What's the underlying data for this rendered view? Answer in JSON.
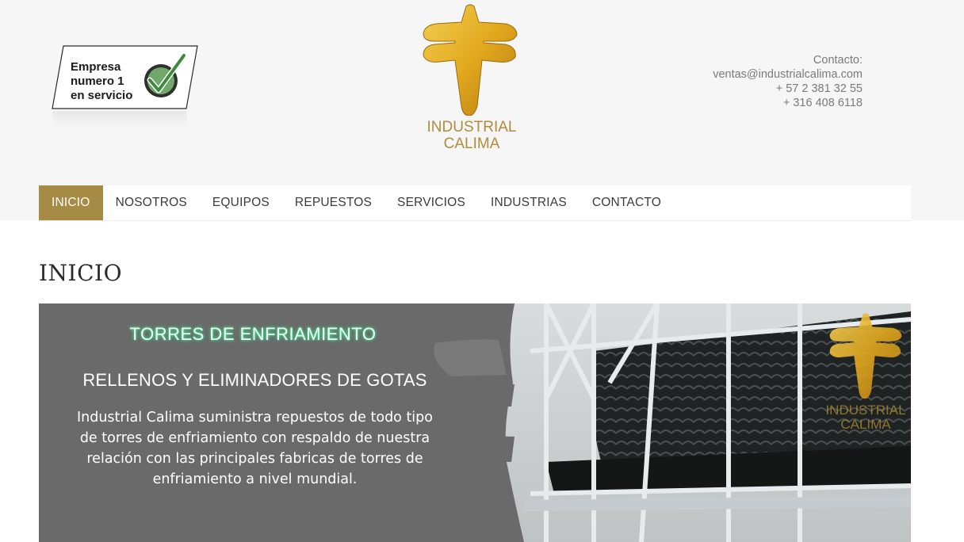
{
  "badge": {
    "lines": [
      "Empresa",
      "numero 1",
      "en servicio"
    ]
  },
  "brand": {
    "name_line1": "INDUSTRIAL",
    "name_line2": "CALIMA",
    "gold": "#b08c3a"
  },
  "contact": {
    "label": "Contacto:",
    "email": "ventas@industrialcalima.com",
    "phone1": "+ 57 2 381 32 55",
    "phone2": "+ 316 408 6118"
  },
  "nav": {
    "items": [
      {
        "label": "INICIO",
        "active": true
      },
      {
        "label": "NOSOTROS"
      },
      {
        "label": "EQUIPOS"
      },
      {
        "label": "REPUESTOS"
      },
      {
        "label": "SERVICIOS"
      },
      {
        "label": "INDUSTRIAS"
      },
      {
        "label": "CONTACTO"
      }
    ],
    "active_color": "#a58b45"
  },
  "page": {
    "title": "INICIO"
  },
  "banner": {
    "heading": "TORRES DE ENFRIAMIENTO",
    "subheading": "RELLENOS Y ELIMINADORES DE GOTAS",
    "body_lines": [
      "Industrial Calima suministra repuestos de todo tipo",
      "de torres de enfriamiento con respaldo de nuestra",
      "relación con las principales fabricas de torres de",
      "enfriamiento a nivel mundial."
    ],
    "logo_line1": "INDUSTRIAL",
    "logo_line2": "CALIMA"
  }
}
